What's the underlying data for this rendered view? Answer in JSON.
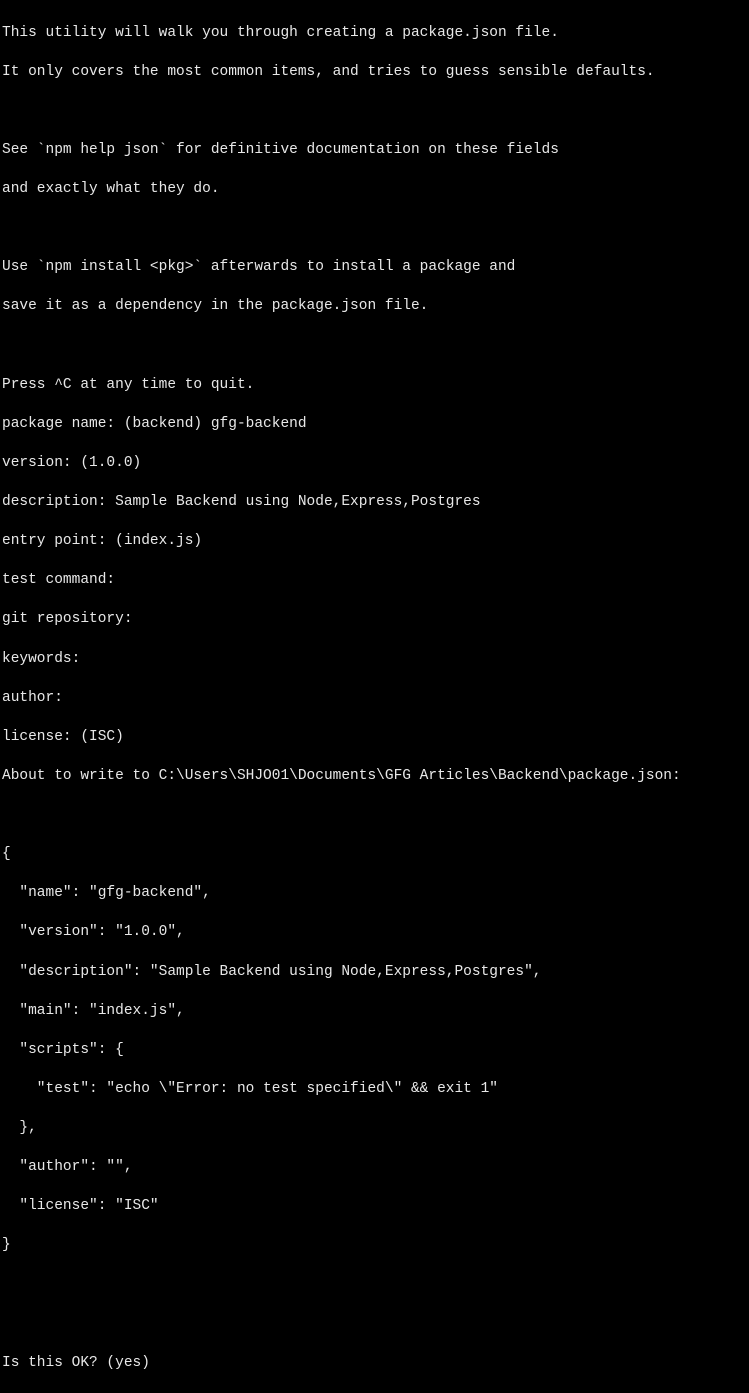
{
  "terminal": {
    "intro": {
      "line1": "This utility will walk you through creating a package.json file.",
      "line2": "It only covers the most common items, and tries to guess sensible defaults.",
      "line3": "See `npm help json` for definitive documentation on these fields",
      "line4": "and exactly what they do.",
      "line5": "Use `npm install <pkg>` afterwards to install a package and",
      "line6": "save it as a dependency in the package.json file.",
      "line7": "Press ^C at any time to quit."
    },
    "prompts": {
      "package_name": "package name: (backend) gfg-backend",
      "version": "version: (1.0.0)",
      "description": "description: Sample Backend using Node,Express,Postgres",
      "entry_point": "entry point: (index.js)",
      "test_command": "test command:",
      "git_repository": "git repository:",
      "keywords": "keywords:",
      "author": "author:",
      "license": "license: (ISC)",
      "about_to_write": "About to write to C:\\Users\\SHJO01\\Documents\\GFG Articles\\Backend\\package.json:"
    },
    "json_output": {
      "open": "{",
      "name": "  \"name\": \"gfg-backend\",",
      "version": "  \"version\": \"1.0.0\",",
      "description": "  \"description\": \"Sample Backend using Node,Express,Postgres\",",
      "main": "  \"main\": \"index.js\",",
      "scripts_open": "  \"scripts\": {",
      "scripts_test": "    \"test\": \"echo \\\"Error: no test specified\\\" && exit 1\"",
      "scripts_close": "  },",
      "author": "  \"author\": \"\",",
      "license": "  \"license\": \"ISC\"",
      "close": "}"
    },
    "confirm": {
      "prompt": "Is this OK? (yes)"
    }
  }
}
